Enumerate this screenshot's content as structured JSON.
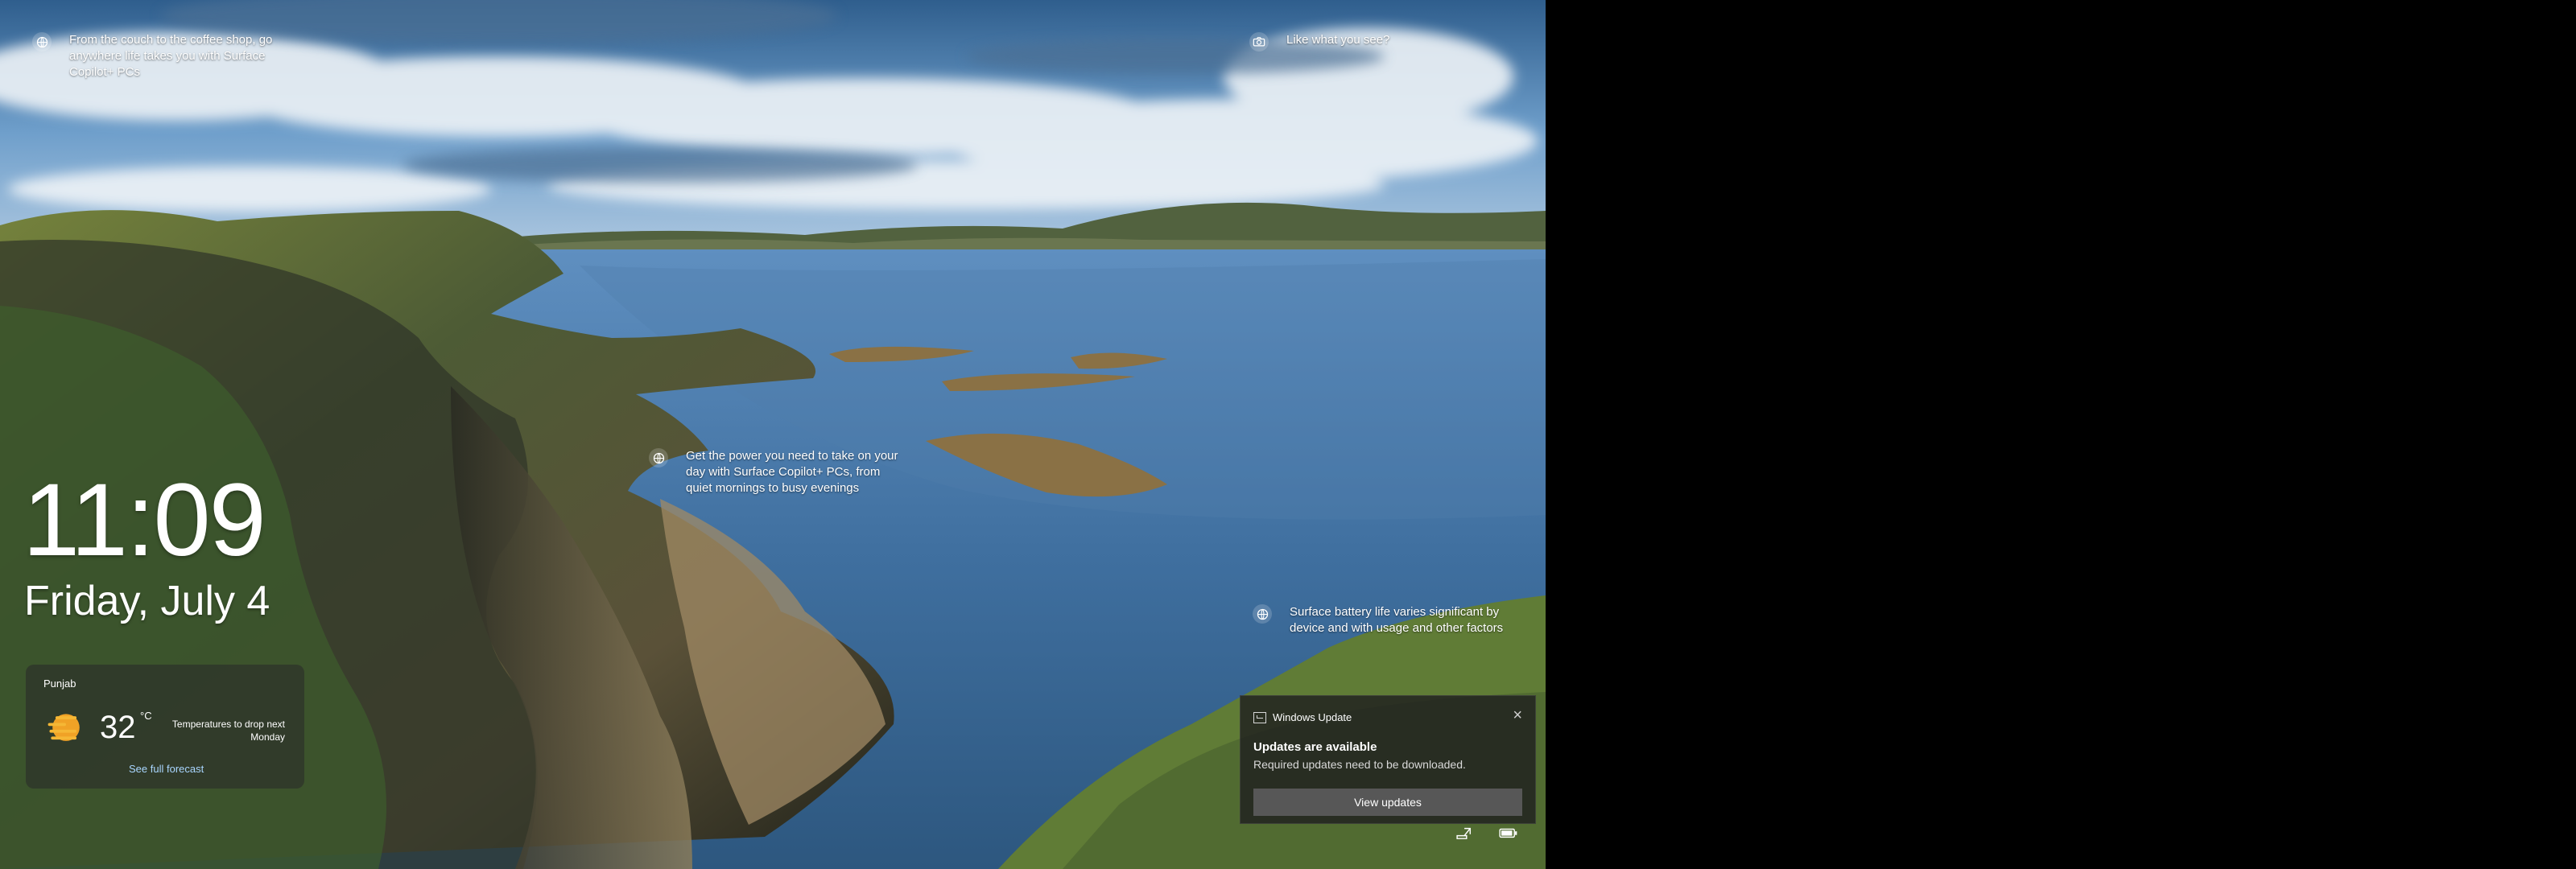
{
  "hints": [
    {
      "name": "hint-top-left",
      "text": "From the couch to the coffee shop, go anywhere life takes you with Surface Copilot+ PCs",
      "icon": "globe-icon"
    },
    {
      "name": "hint-top-right",
      "text": "Like what you see?",
      "icon": "camera-icon"
    },
    {
      "name": "hint-middle",
      "text": "Get the power you need to take on your day with Surface Copilot+ PCs, from quiet mornings to busy evenings",
      "icon": "globe-icon"
    },
    {
      "name": "hint-lower-right",
      "text": "Surface battery life varies significant by device and with usage and other factors",
      "icon": "globe-icon"
    }
  ],
  "clock": {
    "time": "11:09",
    "date": "Friday, July 4"
  },
  "weather": {
    "location": "Punjab",
    "temperature": "32",
    "unit": "°C",
    "description": "Temperatures to drop next Monday",
    "forecast_link": "See full forecast",
    "icon": "sun-haze-icon"
  },
  "notification": {
    "app": "Windows Update",
    "title": "Updates are available",
    "body": "Required updates need to be downloaded.",
    "button": "View updates",
    "close_icon": "close-icon"
  },
  "tray_icons": [
    "network-icon",
    "battery-icon"
  ],
  "colors": {
    "accent": "#a9d6ff",
    "panel": "#202020",
    "button": "#575757"
  }
}
